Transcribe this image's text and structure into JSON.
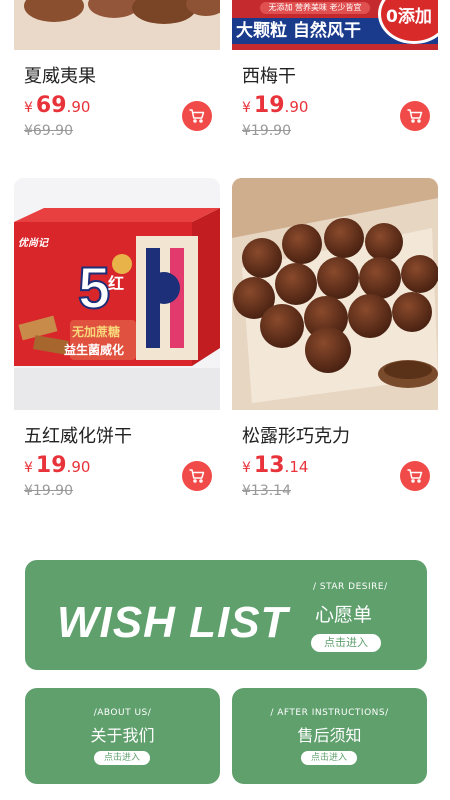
{
  "products": [
    {
      "name": "夏威夷果",
      "currency": "¥",
      "price_int": "69",
      "price_dec": ".90",
      "original": "¥69.90",
      "image": "macadamia-nuts-photo"
    },
    {
      "name": "西梅干",
      "currency": "¥",
      "price_int": "19",
      "price_dec": ".90",
      "original": "¥19.90",
      "image": "prunes-package-photo",
      "image_text": {
        "tag_line": "无添加 营养美味 老少皆宜",
        "main_text": "大颗粒 自然风干",
        "badge_text": "0添加"
      }
    },
    {
      "name": "五红威化饼干",
      "currency": "¥",
      "price_int": "19",
      "price_dec": ".90",
      "original": "¥19.90",
      "image": "wafer-box-photo",
      "image_text": {
        "brand": "优尚记",
        "big_number": "5",
        "red": "红",
        "line1": "无加蔗糖",
        "line2": "益生菌威化"
      }
    },
    {
      "name": "松露形巧克力",
      "currency": "¥",
      "price_int": "13",
      "price_dec": ".14",
      "original": "¥13.14",
      "image": "truffle-chocolate-photo"
    }
  ],
  "wish_banner": {
    "title": "WISH LIST",
    "subtitle_en": "/ STAR DESIRE/",
    "subtitle_cn": "心愿单",
    "button": "点击进入"
  },
  "about_banner": {
    "subtitle_en": "/ABOUT US/",
    "title_cn": "关于我们",
    "button": "点击进入"
  },
  "after_banner": {
    "subtitle_en": "/ AFTER INSTRUCTIONS/",
    "title_cn": "售后须知",
    "button": "点击进入"
  },
  "colors": {
    "accent_red": "#e8333a",
    "cart_red": "#f04b48",
    "banner_green": "#5fa06d"
  }
}
